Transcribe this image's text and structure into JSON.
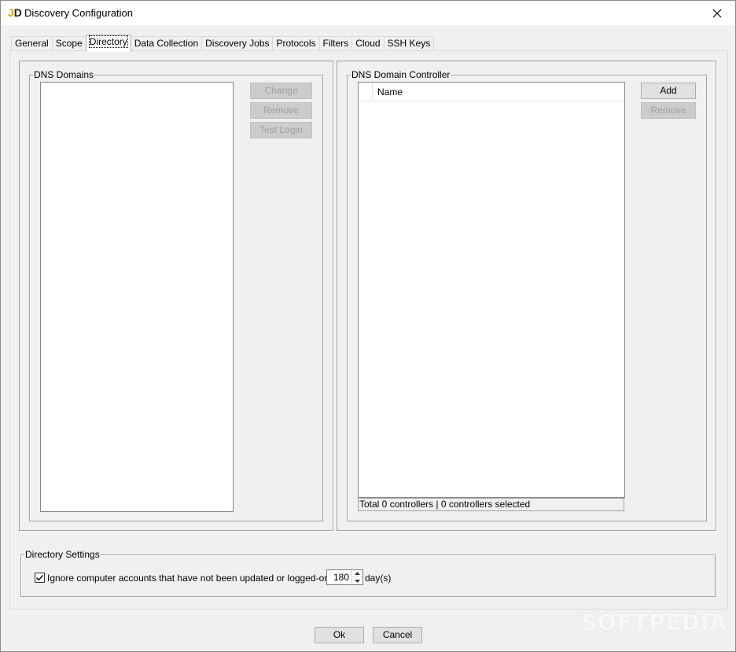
{
  "window": {
    "title": "Discovery Configuration",
    "icon": "jd-app-icon",
    "close_icon": "close-icon"
  },
  "tabs": [
    {
      "label": "General"
    },
    {
      "label": "Scope"
    },
    {
      "label": "Directory",
      "active": true
    },
    {
      "label": "Data Collection"
    },
    {
      "label": "Discovery Jobs"
    },
    {
      "label": "Protocols"
    },
    {
      "label": "Filters"
    },
    {
      "label": "Cloud"
    },
    {
      "label": "SSH Keys"
    }
  ],
  "dns_domains": {
    "group_label": "DNS Domains",
    "buttons": {
      "change": "Change",
      "remove": "Remove",
      "test_login": "Test Login"
    }
  },
  "dns_controller": {
    "group_label": "DNS Domain Controller",
    "column_name": "Name",
    "buttons": {
      "add": "Add",
      "remove": "Remove"
    },
    "status": "Total 0 controllers | 0 controllers selected"
  },
  "directory_settings": {
    "group_label": "Directory Settings",
    "checkbox_label": "Ignore computer accounts that have not been updated or logged-on for",
    "checked": true,
    "days_value": "180",
    "days_unit": "day(s)"
  },
  "footer": {
    "ok_label": "Ok",
    "cancel_label": "Cancel"
  },
  "watermark": "SOFTPEDIA"
}
